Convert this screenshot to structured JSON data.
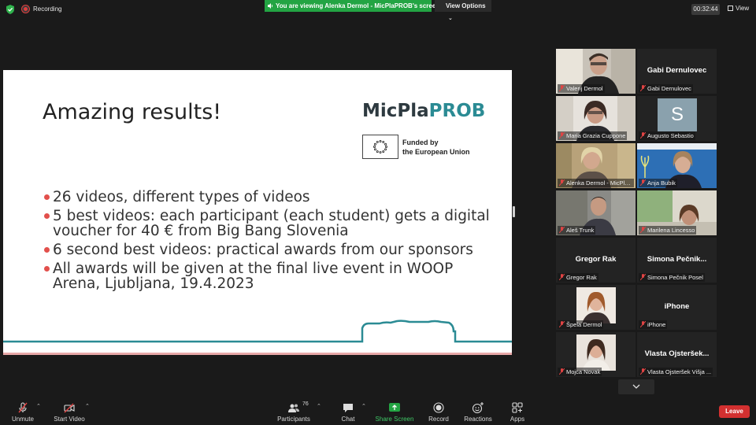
{
  "top_bar": {
    "recording_label": "Recording",
    "viewing_banner": "You are viewing Alenka Dermol - MicPlaPROB's screen",
    "view_options_label": "View Options",
    "timer": "00:32:44",
    "view_label": "View"
  },
  "slide": {
    "title": "Amazing results!",
    "logo_part1": "MicPla",
    "logo_part2": "PROB",
    "eu_line1": "Funded by",
    "eu_line2": "the European Union",
    "bullets": [
      "26 videos, different types of videos",
      "5 best videos: each participant (each student) gets a digital voucher for 40 € from Big Bang Slovenia",
      "6 second best videos: practical awards from our sponsors",
      "All awards will be given at the final live event in WOOP Arena, Ljubljana, 19.4.2023"
    ]
  },
  "participants": [
    {
      "label": "Valerij Dermol",
      "big_name": ""
    },
    {
      "label": "Gabi Dernulovec",
      "big_name": "Gabi Dernulovec"
    },
    {
      "label": "Maria Grazia Cuppone",
      "big_name": ""
    },
    {
      "label": "Augusto Sebastio",
      "big_name": "",
      "avatar_letter": "S"
    },
    {
      "label": "Alenka Dermol - MicPlaPR...",
      "big_name": ""
    },
    {
      "label": "Anja Bubik",
      "big_name": ""
    },
    {
      "label": "Aleš Trunk",
      "big_name": ""
    },
    {
      "label": "Marilena Lincesso",
      "big_name": ""
    },
    {
      "label": "Gregor Rak",
      "big_name": "Gregor Rak"
    },
    {
      "label": "Simona Pečnik Posel",
      "big_name": "Simona Pečnik..."
    },
    {
      "label": "Špela Dermol",
      "big_name": ""
    },
    {
      "label": "iPhone",
      "big_name": "iPhone"
    },
    {
      "label": "Mojca Novak",
      "big_name": ""
    },
    {
      "label": "Vlasta Ojsteršek Višja ...",
      "big_name": "Vlasta Ojsteršek..."
    }
  ],
  "toolbar": {
    "unmute": "Unmute",
    "start_video": "Start Video",
    "participants": "Participants",
    "participant_count": "76",
    "chat": "Chat",
    "share_screen": "Share Screen",
    "record": "Record",
    "reactions": "Reactions",
    "apps": "Apps",
    "leave": "Leave"
  },
  "colors": {
    "banner_green": "#23a443",
    "leave_red": "#d23030",
    "bullet_red": "#e2504c",
    "logo_teal": "#2b8b94",
    "active_speaker_yellow": "#d9d24a"
  },
  "icons": [
    "shield-icon",
    "record-dot-icon",
    "sound-bars-icon",
    "chevron-down-icon",
    "grid-icon",
    "muted-mic-icon",
    "video-off-icon",
    "participants-icon",
    "chat-icon",
    "share-screen-icon",
    "record-icon",
    "reactions-icon",
    "apps-icon"
  ]
}
